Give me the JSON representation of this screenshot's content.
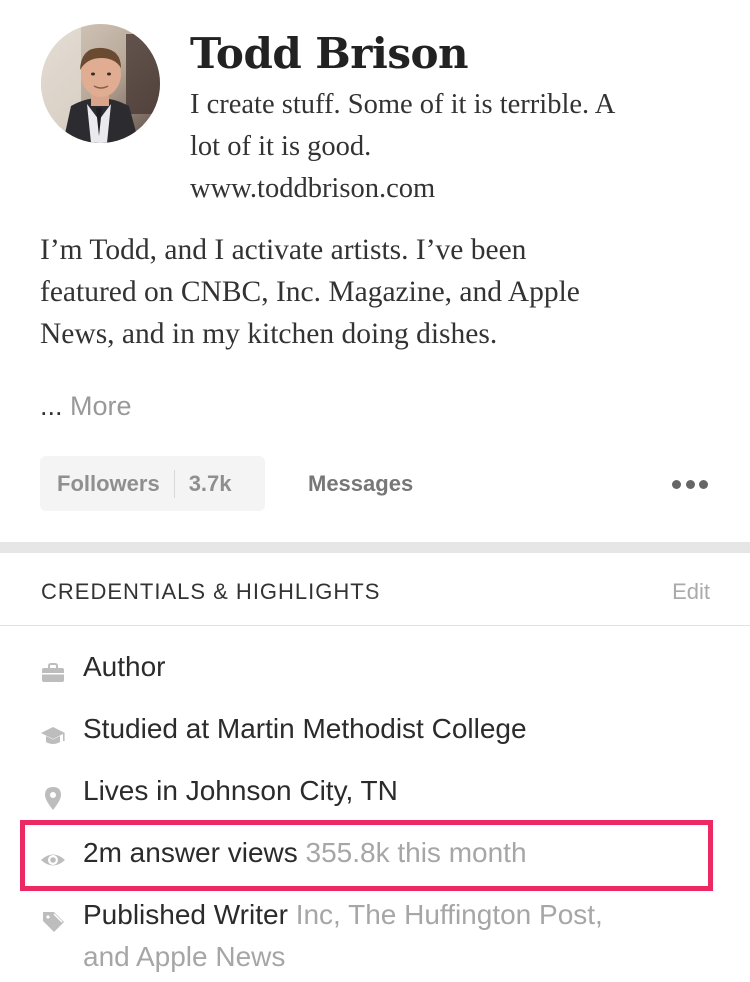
{
  "profile": {
    "name": "Todd Brison",
    "tagline_lines": [
      "I create stuff. Some of it is terrible. A",
      "lot of it is good.",
      "www.toddbrison.com"
    ],
    "bio_lines": [
      "I’m Todd, and I activate artists. I’ve been",
      "featured on CNBC, Inc. Magazine, and Apple",
      "News, and in my kitchen doing dishes."
    ],
    "ellipsis": "...",
    "more_label": "More"
  },
  "actions": {
    "followers_label": "Followers",
    "followers_count": "3.7k",
    "messages_label": "Messages",
    "overflow_icon": "more-horizontal-icon"
  },
  "credentials": {
    "section_title": "CREDENTIALS & HIGHLIGHTS",
    "edit_label": "Edit",
    "items": [
      {
        "icon": "briefcase-icon",
        "label": "Author",
        "sub": ""
      },
      {
        "icon": "graduation-cap-icon",
        "label": "Studied at Martin Methodist College",
        "sub": ""
      },
      {
        "icon": "location-pin-icon",
        "label": "Lives in Johnson City, TN",
        "sub": ""
      },
      {
        "icon": "eye-icon",
        "label": "2m answer views",
        "sub": "355.8k this month"
      },
      {
        "icon": "pencil-icon",
        "label": "Published Writer",
        "sub": "Inc, The Huffington Post,",
        "sub_line2": "and Apple News"
      }
    ]
  },
  "colors": {
    "highlight_border": "#ee2862",
    "muted_text": "#a6a6a6",
    "separator": "#e6e6e6"
  }
}
